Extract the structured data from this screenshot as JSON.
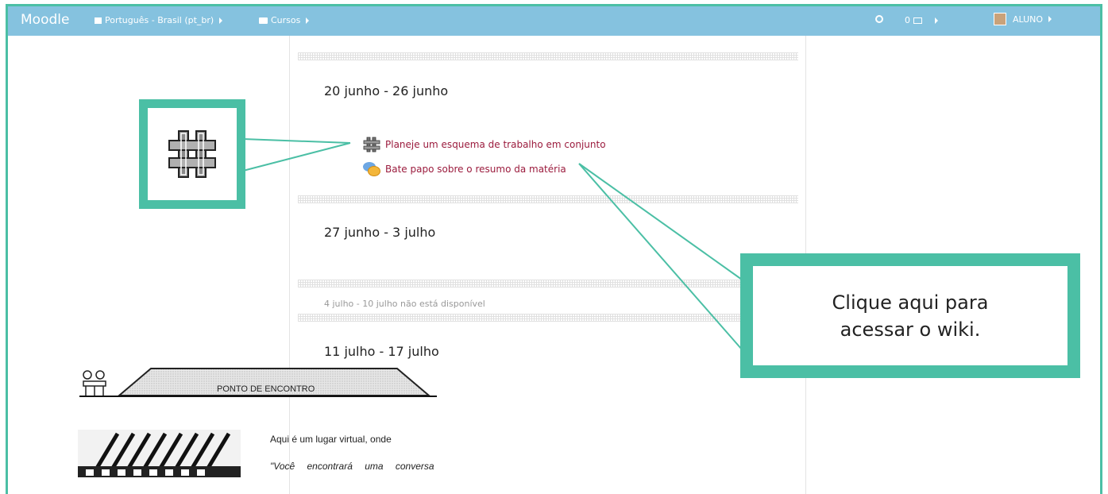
{
  "navbar": {
    "brand": "Moodle",
    "language": "Português - Brasil (pt_br)",
    "courses": "Cursos",
    "messages_count": "0",
    "user": "ALUNO"
  },
  "sections": [
    {
      "title": "20 junho - 26 junho"
    },
    {
      "title": "27 junho - 3 julho"
    },
    {
      "title": "11 julho - 17 julho"
    }
  ],
  "activities": [
    {
      "label": "Planeje um esquema de trabalho em conjunto",
      "icon": "wiki-icon"
    },
    {
      "label": "Bate papo sobre o resumo da matéria",
      "icon": "chat-icon"
    }
  ],
  "unavailable_section": "4 julho - 10 julho não está disponível",
  "banner": {
    "title": "PONTO DE ENCONTRO",
    "text": "Aqui é um lugar virtual, onde",
    "quote": "\"Você encontrará uma conversa"
  },
  "callout": {
    "text": "Clique aqui para acessar o wiki."
  },
  "colors": {
    "accent": "#4bbfa5",
    "navbar": "#85c2df",
    "link": "#9b1b3d"
  }
}
